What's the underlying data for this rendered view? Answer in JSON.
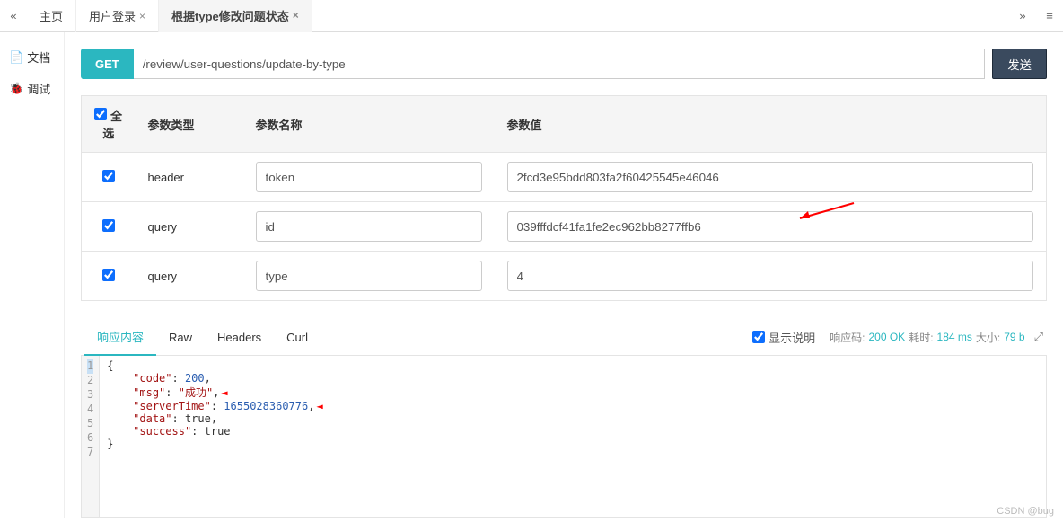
{
  "topTabs": {
    "home": "主页",
    "login": "用户登录",
    "current": "根据type修改问题状态"
  },
  "sidebar": {
    "doc": "文档",
    "debug": "调试"
  },
  "request": {
    "method": "GET",
    "url": "/review/user-questions/update-by-type",
    "sendLabel": "发送"
  },
  "paramsTable": {
    "headers": {
      "selectAll": "全选",
      "type": "参数类型",
      "name": "参数名称",
      "value": "参数值"
    },
    "rows": [
      {
        "type": "header",
        "name": "token",
        "value": "2fcd3e95bdd803fa2f60425545e46046"
      },
      {
        "type": "query",
        "name": "id",
        "value": "039fffdcf41fa1fe2ec962bb8277ffb6"
      },
      {
        "type": "query",
        "name": "type",
        "value": "4"
      }
    ]
  },
  "responseTabs": {
    "content": "响应内容",
    "raw": "Raw",
    "headers": "Headers",
    "curl": "Curl",
    "showDesc": "显示说明",
    "codeLabel": "响应码:",
    "codeVal": "200 OK",
    "timeLabel": "耗时:",
    "timeVal": "184 ms",
    "sizeLabel": "大小:",
    "sizeVal": "79 b"
  },
  "responseBody": {
    "code": 200,
    "msg": "成功",
    "serverTime": 1655028360776,
    "data": true,
    "success": true
  },
  "watermark": "CSDN @bug"
}
